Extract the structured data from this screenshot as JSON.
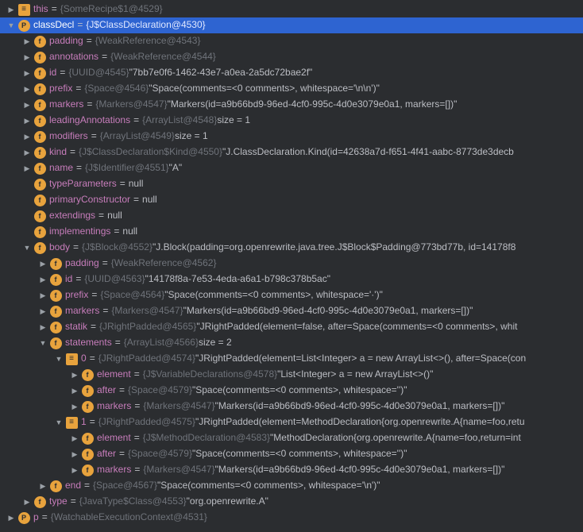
{
  "rows": [
    {
      "indent": 0,
      "arrow": ">",
      "icon": "list",
      "name": "this",
      "ref": "{SomeRecipe$1@4529}",
      "val": ""
    },
    {
      "indent": 0,
      "arrow": "v",
      "icon": "p",
      "name": "classDecl",
      "ref": "{J$ClassDeclaration@4530}",
      "val": "",
      "selected": true
    },
    {
      "indent": 1,
      "arrow": ">",
      "icon": "f",
      "name": "padding",
      "ref": "{WeakReference@4543}",
      "val": ""
    },
    {
      "indent": 1,
      "arrow": ">",
      "icon": "f",
      "name": "annotations",
      "ref": "{WeakReference@4544}",
      "val": ""
    },
    {
      "indent": 1,
      "arrow": ">",
      "icon": "f",
      "name": "id",
      "ref": "{UUID@4545}",
      "val": "\"7bb7e0f6-1462-43e7-a0ea-2a5dc72bae2f\""
    },
    {
      "indent": 1,
      "arrow": ">",
      "icon": "f",
      "name": "prefix",
      "ref": "{Space@4546}",
      "val": "\"Space(comments=<0 comments>, whitespace='\\n\\n')\""
    },
    {
      "indent": 1,
      "arrow": ">",
      "icon": "f",
      "name": "markers",
      "ref": "{Markers@4547}",
      "val": "\"Markers(id=a9b66bd9-96ed-4cf0-995c-4d0e3079e0a1, markers=[])\""
    },
    {
      "indent": 1,
      "arrow": ">",
      "icon": "f",
      "name": "leadingAnnotations",
      "ref": "{ArrayList@4548}",
      "val": " size = 1"
    },
    {
      "indent": 1,
      "arrow": ">",
      "icon": "f",
      "name": "modifiers",
      "ref": "{ArrayList@4549}",
      "val": " size = 1"
    },
    {
      "indent": 1,
      "arrow": ">",
      "icon": "f",
      "name": "kind",
      "ref": "{J$ClassDeclaration$Kind@4550}",
      "val": "\"J.ClassDeclaration.Kind(id=42638a7d-f651-4f41-aabc-8773de3decb"
    },
    {
      "indent": 1,
      "arrow": ">",
      "icon": "f",
      "name": "name",
      "ref": "{J$Identifier@4551}",
      "val": "\"A\""
    },
    {
      "indent": 1,
      "arrow": "",
      "icon": "f",
      "name": "typeParameters",
      "ref": "",
      "val": "null"
    },
    {
      "indent": 1,
      "arrow": "",
      "icon": "f",
      "name": "primaryConstructor",
      "ref": "",
      "val": "null"
    },
    {
      "indent": 1,
      "arrow": "",
      "icon": "f",
      "name": "extendings",
      "ref": "",
      "val": "null"
    },
    {
      "indent": 1,
      "arrow": "",
      "icon": "f",
      "name": "implementings",
      "ref": "",
      "val": "null"
    },
    {
      "indent": 1,
      "arrow": "v",
      "icon": "f",
      "name": "body",
      "ref": "{J$Block@4552}",
      "val": "\"J.Block(padding=org.openrewrite.java.tree.J$Block$Padding@773bd77b, id=14178f8"
    },
    {
      "indent": 2,
      "arrow": ">",
      "icon": "f",
      "name": "padding",
      "ref": "{WeakReference@4562}",
      "val": ""
    },
    {
      "indent": 2,
      "arrow": ">",
      "icon": "f",
      "name": "id",
      "ref": "{UUID@4563}",
      "val": "\"14178f8a-7e53-4eda-a6a1-b798c378b5ac\""
    },
    {
      "indent": 2,
      "arrow": ">",
      "icon": "f",
      "name": "prefix",
      "ref": "{Space@4564}",
      "val": "\"Space(comments=<0 comments>, whitespace='·')\""
    },
    {
      "indent": 2,
      "arrow": ">",
      "icon": "f",
      "name": "markers",
      "ref": "{Markers@4547}",
      "val": "\"Markers(id=a9b66bd9-96ed-4cf0-995c-4d0e3079e0a1, markers=[])\""
    },
    {
      "indent": 2,
      "arrow": ">",
      "icon": "f",
      "name": "statik",
      "ref": "{JRightPadded@4565}",
      "val": "\"JRightPadded(element=false, after=Space(comments=<0 comments>, whit"
    },
    {
      "indent": 2,
      "arrow": "v",
      "icon": "f",
      "name": "statements",
      "ref": "{ArrayList@4566}",
      "val": " size = 2"
    },
    {
      "indent": 3,
      "arrow": "v",
      "icon": "list",
      "name": "0",
      "ref": "{JRightPadded@4574}",
      "val": "\"JRightPadded(element=List<Integer> a = new ArrayList<>(), after=Space(con"
    },
    {
      "indent": 4,
      "arrow": ">",
      "icon": "f",
      "name": "element",
      "ref": "{J$VariableDeclarations@4578}",
      "val": "\"List<Integer> a = new ArrayList<>()\""
    },
    {
      "indent": 4,
      "arrow": ">",
      "icon": "f",
      "name": "after",
      "ref": "{Space@4579}",
      "val": "\"Space(comments=<0 comments>, whitespace='')\""
    },
    {
      "indent": 4,
      "arrow": ">",
      "icon": "f",
      "name": "markers",
      "ref": "{Markers@4547}",
      "val": "\"Markers(id=a9b66bd9-96ed-4cf0-995c-4d0e3079e0a1, markers=[])\""
    },
    {
      "indent": 3,
      "arrow": "v",
      "icon": "list",
      "name": "1",
      "ref": "{JRightPadded@4575}",
      "val": "\"JRightPadded(element=MethodDeclaration{org.openrewrite.A{name=foo,retu"
    },
    {
      "indent": 4,
      "arrow": ">",
      "icon": "f",
      "name": "element",
      "ref": "{J$MethodDeclaration@4583}",
      "val": "\"MethodDeclaration{org.openrewrite.A{name=foo,return=int"
    },
    {
      "indent": 4,
      "arrow": ">",
      "icon": "f",
      "name": "after",
      "ref": "{Space@4579}",
      "val": "\"Space(comments=<0 comments>, whitespace='')\""
    },
    {
      "indent": 4,
      "arrow": ">",
      "icon": "f",
      "name": "markers",
      "ref": "{Markers@4547}",
      "val": "\"Markers(id=a9b66bd9-96ed-4cf0-995c-4d0e3079e0a1, markers=[])\""
    },
    {
      "indent": 2,
      "arrow": ">",
      "icon": "f",
      "name": "end",
      "ref": "{Space@4567}",
      "val": "\"Space(comments=<0 comments>, whitespace='\\n')\""
    },
    {
      "indent": 1,
      "arrow": ">",
      "icon": "f",
      "name": "type",
      "ref": "{JavaType$Class@4553}",
      "val": "\"org.openrewrite.A\""
    },
    {
      "indent": 0,
      "arrow": ">",
      "icon": "p",
      "name": "p",
      "ref": "{WatchableExecutionContext@4531}",
      "val": ""
    }
  ],
  "glyphs": {
    "f": "f",
    "p": "P",
    "list": "≡"
  },
  "arrows": {
    ">": "▶",
    "v": "▼",
    "": ""
  }
}
